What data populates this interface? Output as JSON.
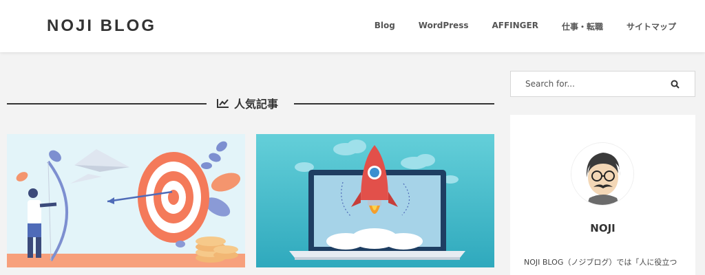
{
  "header": {
    "logo": "NOJI BLOG",
    "nav": [
      "Blog",
      "WordPress",
      "AFFINGER",
      "仕事・転職",
      "サイトマップ"
    ]
  },
  "section": {
    "title": "人気記事"
  },
  "search": {
    "placeholder": "Search for..."
  },
  "profile": {
    "name": "NOJI",
    "description": "NOJI BLOG（ノジブログ）では「人に役立つ"
  },
  "colors": {
    "accent": "#333333",
    "target": "#f47a5a",
    "rocket": "#e2504a",
    "teal": "#3bb6c6"
  },
  "icons": [
    "trending-up-icon",
    "search-icon"
  ]
}
